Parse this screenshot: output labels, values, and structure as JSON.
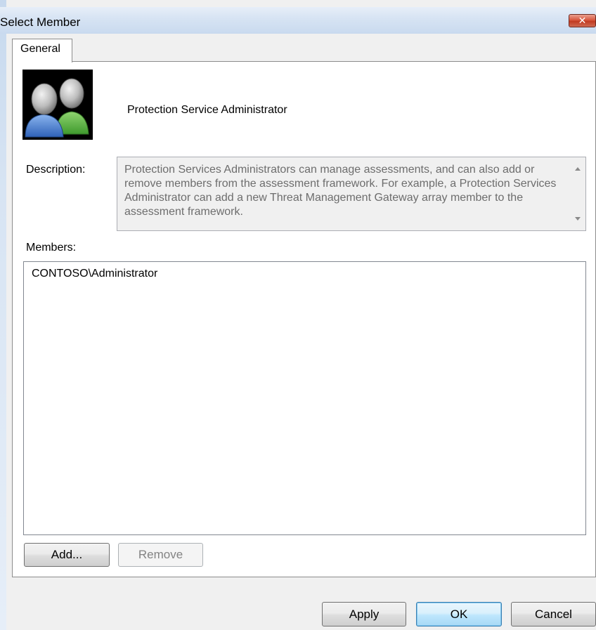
{
  "window": {
    "title": "Select Member",
    "close_glyph": "✕"
  },
  "tabs": [
    {
      "label": "General",
      "selected": true
    }
  ],
  "group": {
    "icon": "users-icon",
    "name": "Protection Service Administrator"
  },
  "description": {
    "label": "Description:",
    "text": "Protection Services Administrators can manage assessments, and can also add or remove members from the assessment framework. For example, a Protection Services Administrator can add a new Threat Management Gateway array member to the assessment framework."
  },
  "members": {
    "label": "Members:",
    "items": [
      "CONTOSO\\Administrator"
    ]
  },
  "buttons": {
    "add": "Add...",
    "remove": "Remove",
    "apply": "Apply",
    "ok": "OK",
    "cancel": "Cancel"
  }
}
